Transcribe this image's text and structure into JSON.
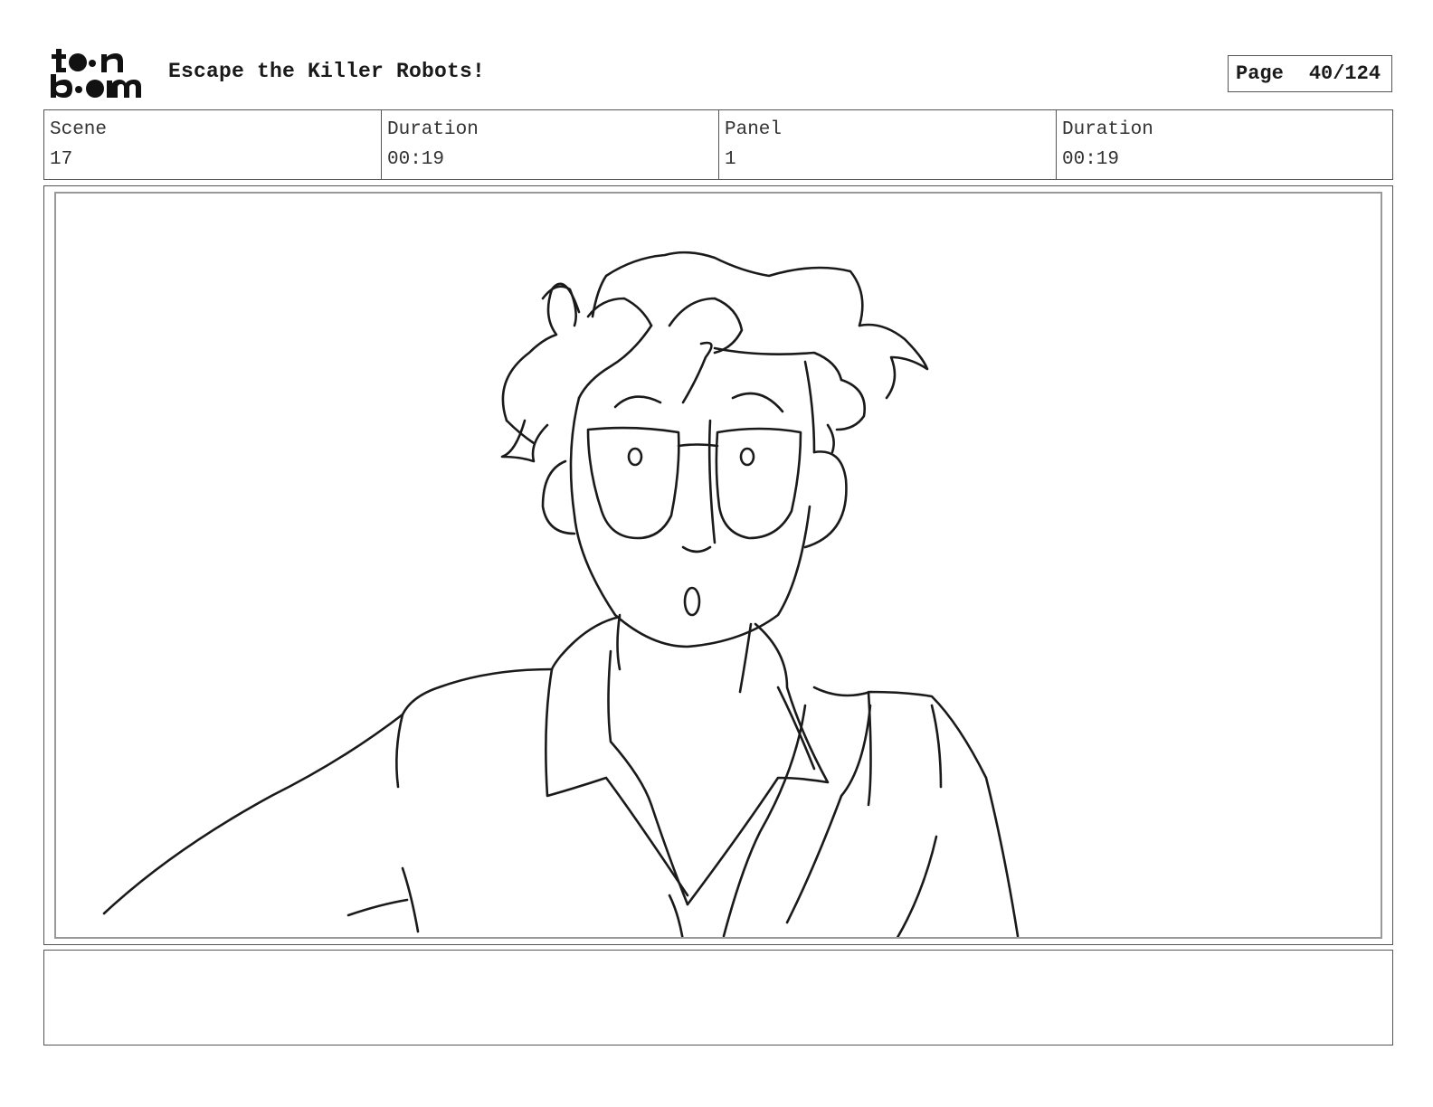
{
  "header": {
    "logo_text": "toon boom",
    "project_title": "Escape the Killer Robots!",
    "page_label": "Page",
    "page_value": "40/124"
  },
  "info": {
    "scene_label": "Scene",
    "scene_value": "17",
    "scene_duration_label": "Duration",
    "scene_duration_value": "00:19",
    "panel_label": "Panel",
    "panel_value": "1",
    "panel_duration_label": "Duration",
    "panel_duration_value": "00:19"
  },
  "panel": {
    "drawing": "storyboard-sketch"
  },
  "notes": {
    "text": ""
  },
  "colors": {
    "ink": "#1a1a1a",
    "border": "#555555",
    "inner_border": "#999999",
    "background": "#ffffff"
  }
}
